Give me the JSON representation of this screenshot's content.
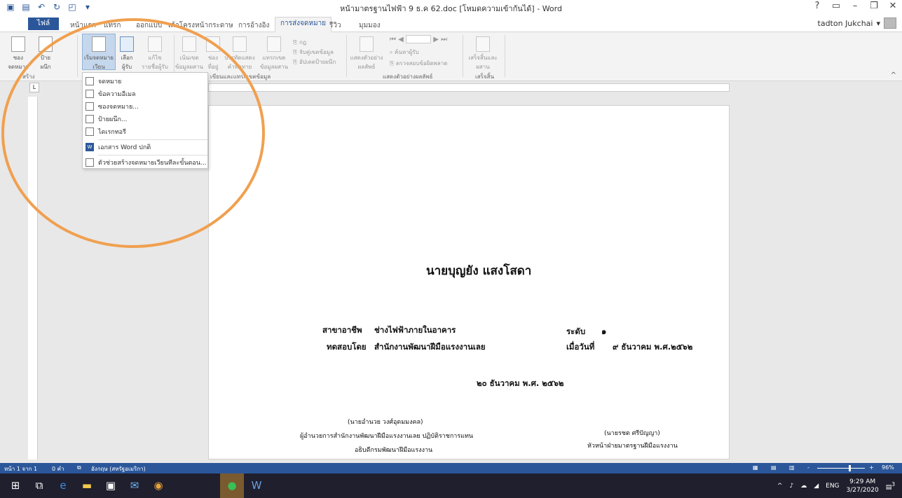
{
  "window": {
    "title": "หน้ามาตรฐานไฟฟ้า 9 ธ.ค 62.doc [โหมดความเข้ากันได้] - Word",
    "help": "?",
    "user": "tadton Jukchai"
  },
  "tabs": {
    "file": "ไฟล์",
    "items": [
      "หน้าแรก",
      "แทรก",
      "ออกแบบ",
      "เค้าโครงหน้ากระดาษ",
      "การอ้างอิง",
      "การส่งจดหมาย",
      "รีวิว",
      "มุมมอง"
    ],
    "active": "การส่งจดหมาย"
  },
  "ribbon": {
    "buttons": [
      {
        "label": "ซอง\nจดหมาย"
      },
      {
        "label": "ป้าย\nผนึก"
      },
      {
        "label": "เริ่มจดหมาย\nเวียน"
      },
      {
        "label": "เลือก\nผู้รับ"
      },
      {
        "label": "แก้ไข\nรายชื่อผู้รับ"
      },
      {
        "label": "เน้นเขต\nข้อมูลผสาน"
      },
      {
        "label": "ช่อง\nที่อยู่"
      },
      {
        "label": "บรรทัดแสดง\nคำทักทาย"
      },
      {
        "label": "แทรกเขต\nข้อมูลผสาน"
      },
      {
        "label": "แสดงตัวอย่าง\nผลลัพธ์"
      },
      {
        "label": "เสร็จสิ้นและ\nผสาน"
      }
    ],
    "small": [
      "กฎ",
      "จับคู่เขตข้อมูล",
      "อัปเดตป้ายผนึก",
      "ค้นหาผู้รับ",
      "ตรวจสอบข้อผิดพลาด"
    ],
    "groups": [
      "สร้าง",
      "เขียนและแทรกเขตข้อมูล",
      "แสดงตัวอย่างผลลัพธ์",
      "เสร็จสิ้น"
    ]
  },
  "ruler": {
    "corner": "L"
  },
  "dropdown": {
    "items": [
      "จดหมาย",
      "ข้อความอีเมล",
      "ซองจดหมาย...",
      "ป้ายผนึก...",
      "ไดเรกทอรี",
      "เอกสาร Word ปกติ",
      "ตัวช่วยสร้างจดหมายเวียนทีละขั้นตอน..."
    ]
  },
  "document": {
    "name": "นายบุญยัง        แสงโสดา",
    "field_label": "สาขาอาชีพ",
    "field_value": "ช่างไฟฟ้าภายในอาคาร",
    "level_label": "ระดับ",
    "level_value": "๑",
    "tested_by_label": "ทดสอบโดย",
    "tested_by_value": "สำนักงานพัฒนาฝีมือแรงงานเลย",
    "date_label": "เมื่อวันที่",
    "date_value": "๙  ธันวาคม  พ.ศ.๒๕๖๒",
    "issue_date": "๒๐ ธันวาคม  พ.ศ. ๒๕๖๒",
    "signer1_name": "(นายอำนวย  วงศ์อุดมมงคล)",
    "signer1_title": "ผู้อำนวยการสำนักงานพัฒนาฝีมือแรงงานเลย  ปฏิบัติราชการแทน",
    "signer1_title2": "อธิบดีกรมพัฒนาฝีมือแรงงาน",
    "signer2_name": "(นายรชต  ศรีปัญญา)",
    "signer2_title": "หัวหน้าฝ่ายมาตรฐานฝีมือแรงงาน"
  },
  "statusbar": {
    "page": "หน้า 1 จาก 1",
    "words": "0 คำ",
    "language": "อังกฤษ (สหรัฐอเมริกา)",
    "zoom": "96%",
    "zoom_minus": "-",
    "zoom_plus": "+"
  },
  "taskbar": {
    "lang": "ENG",
    "time": "9:29 AM",
    "date": "3/27/2020",
    "notif_count": "3"
  },
  "colors": {
    "word_blue": "#2b579a",
    "annotation": "#f0a050"
  }
}
